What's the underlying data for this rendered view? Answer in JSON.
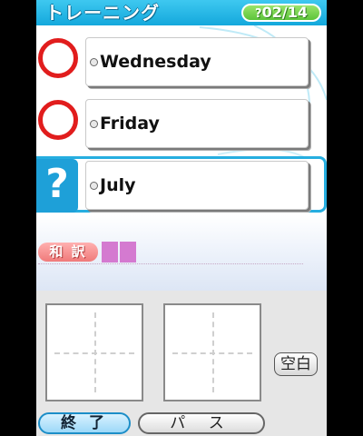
{
  "header": {
    "title": "トレーニング",
    "counter_icon": "?",
    "counter": "02/14"
  },
  "items": [
    {
      "word": "Wednesday",
      "status": "correct"
    },
    {
      "word": "Friday",
      "status": "correct"
    },
    {
      "word": "July",
      "status": "current",
      "status_symbol": "?"
    }
  ],
  "translation": {
    "label": "和 訳",
    "answer_slots": 2
  },
  "writing": {
    "space_label": "空白"
  },
  "buttons": {
    "end_label": "終 了",
    "pass_label": "パ ス"
  },
  "colors": {
    "header": "#1ea0d8",
    "correct_mark": "#e11d1d",
    "active_border": "#26aee0",
    "answer_slot": "#d47ad0"
  }
}
